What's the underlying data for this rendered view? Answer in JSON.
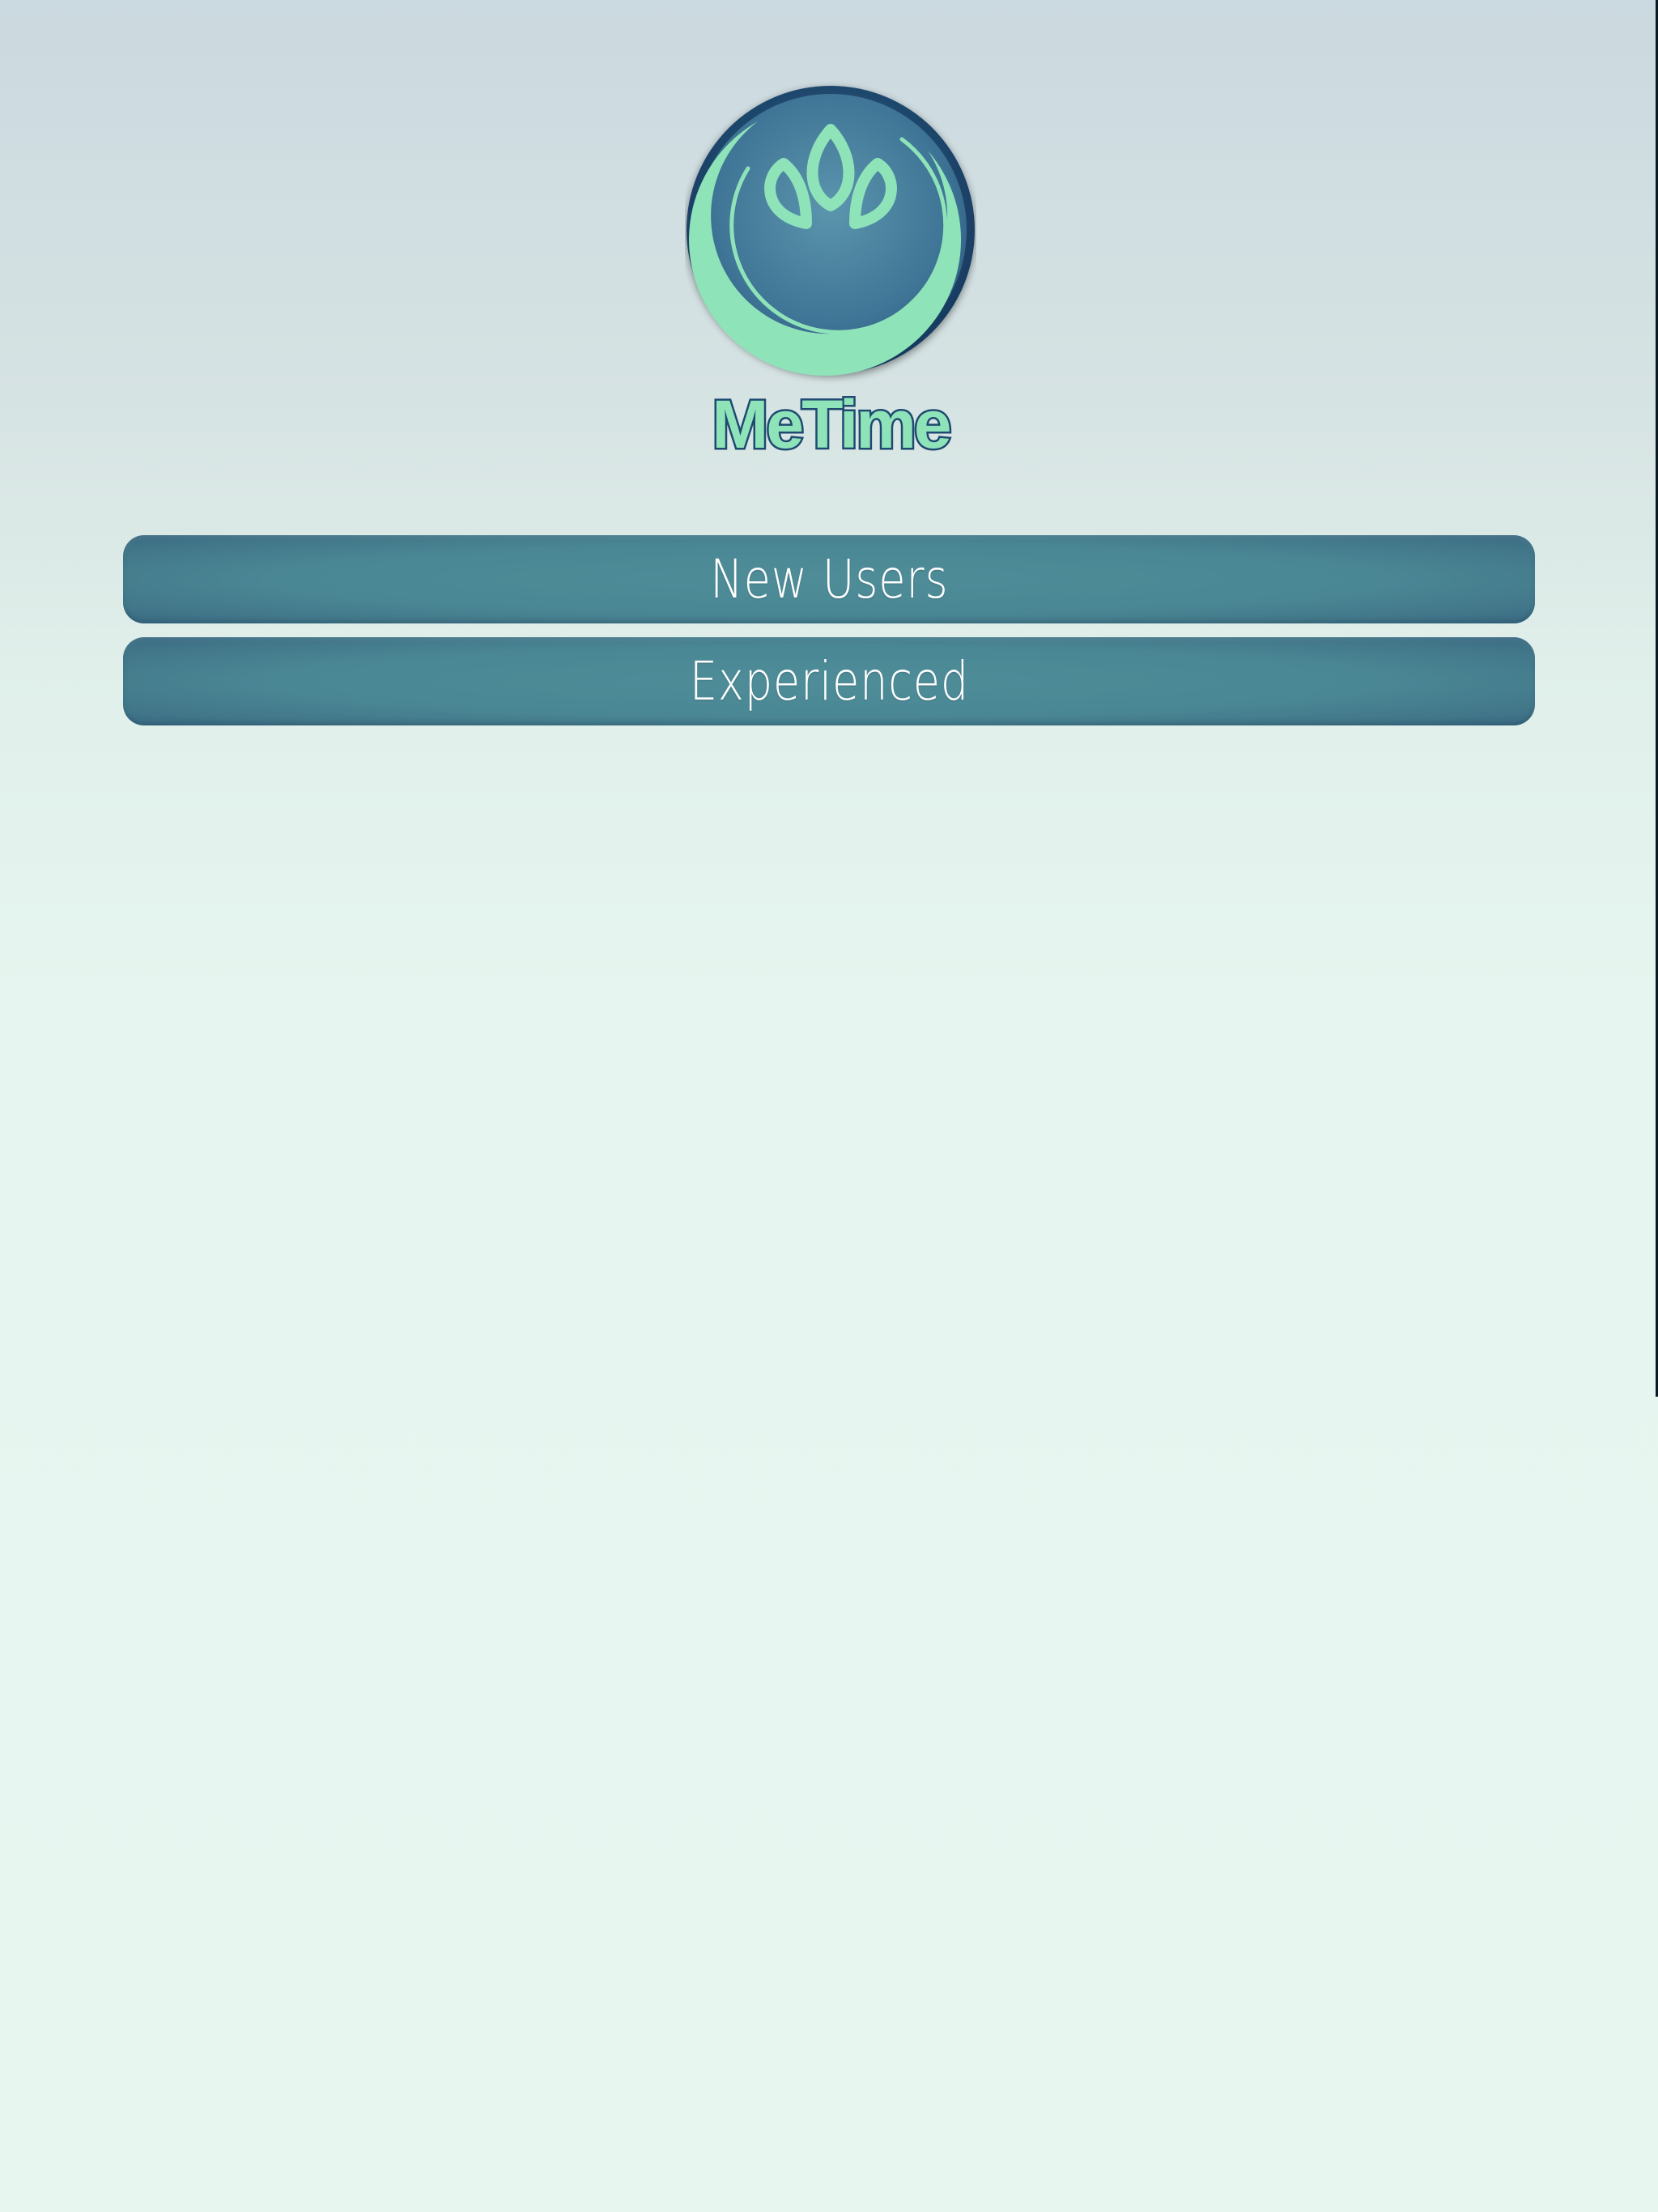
{
  "app": {
    "logo_text": "MeTime",
    "logo_icon": "lotus-icon"
  },
  "menu": {
    "new_users_label": "New Users",
    "experienced_label": "Experienced"
  },
  "colors": {
    "button": "#4a8795",
    "button_edge": "#3a6a84",
    "logo_ring": "#1e4a70",
    "logo_accent": "#8fe3b9",
    "background_top": "#cbd9e0",
    "background_bottom": "#e8f6f0"
  }
}
